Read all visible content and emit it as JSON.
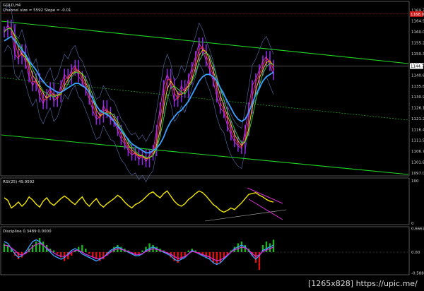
{
  "chart_data": [
    {
      "type": "line",
      "header_symbol": "GOLD,H4",
      "header_info": "Channel size = 5592 Slope = -0.01",
      "ylim": [
        1096,
        1173
      ],
      "y_ticks": [
        1169.75,
        1164.9,
        1160.05,
        1155.2,
        1150.35,
        1145.5,
        1140.65,
        1135.8,
        1130.95,
        1126.1,
        1121.25,
        1116.4,
        1111.55,
        1106.7,
        1101.85,
        1097.0
      ],
      "current_price": 1144.75,
      "level_price": 1168.0,
      "series": [
        {
          "kind": "price",
          "color": "#8a2be2",
          "values": [
            1160,
            1163,
            1161,
            1150,
            1148,
            1152,
            1146,
            1140,
            1136,
            1139,
            1131,
            1128,
            1132,
            1135,
            1129,
            1131,
            1136,
            1141,
            1139,
            1143,
            1145,
            1140,
            1138,
            1134,
            1130,
            1125,
            1121,
            1122,
            1127,
            1124,
            1121,
            1120,
            1116,
            1112,
            1110,
            1107,
            1105,
            1106,
            1103,
            1105,
            1102,
            1105,
            1107,
            1116,
            1126,
            1136,
            1141,
            1137,
            1129,
            1131,
            1136,
            1133,
            1139,
            1144,
            1149,
            1155,
            1152,
            1147,
            1143,
            1138,
            1131,
            1126,
            1124,
            1118,
            1114,
            1111,
            1109,
            1108,
            1116,
            1126,
            1136,
            1139,
            1143,
            1147,
            1149,
            1145,
            1141
          ]
        },
        {
          "kind": "ma_blue",
          "color": "#3aa0ff",
          "values": [
            1156,
            1157,
            1158,
            1156,
            1154,
            1152,
            1150,
            1147,
            1145,
            1143,
            1140,
            1138,
            1136,
            1135,
            1134,
            1133,
            1133,
            1134,
            1135,
            1136,
            1137,
            1137,
            1136,
            1135,
            1133,
            1130,
            1127,
            1125,
            1124,
            1123,
            1122,
            1120,
            1118,
            1116,
            1114,
            1112,
            1110,
            1109,
            1108,
            1107,
            1106,
            1106,
            1107,
            1108,
            1110,
            1113,
            1117,
            1120,
            1122,
            1124,
            1125,
            1127,
            1129,
            1132,
            1135,
            1138,
            1140,
            1141,
            1141,
            1140,
            1138,
            1135,
            1132,
            1129,
            1126,
            1123,
            1121,
            1120,
            1121,
            1124,
            1128,
            1132,
            1135,
            1138,
            1140,
            1141,
            1142
          ]
        }
      ]
    },
    {
      "type": "line",
      "title": "RSI(25) 49.9592",
      "ylim": [
        0,
        100
      ],
      "y_ticks": [
        100,
        0
      ],
      "series": [
        {
          "name": "RSI(25)",
          "color": "#f2e600",
          "values": [
            60,
            54,
            36,
            42,
            50,
            40,
            48,
            62,
            55,
            45,
            38,
            52,
            60,
            48,
            42,
            50,
            58,
            64,
            58,
            50,
            44,
            54,
            62,
            48,
            40,
            50,
            58,
            45,
            38,
            46,
            52,
            58,
            66,
            60,
            50,
            42,
            36,
            44,
            48,
            54,
            62,
            70,
            74,
            66,
            60,
            70,
            76,
            64,
            52,
            44,
            40,
            46,
            56,
            62,
            70,
            76,
            72,
            64,
            54,
            44,
            38,
            30,
            26,
            30,
            36,
            32,
            40,
            48,
            58,
            68,
            70,
            72,
            66,
            62,
            56,
            52,
            49.96
          ]
        }
      ]
    },
    {
      "type": "bar",
      "title": "Discipline 0.3489 0.0000",
      "ylim": [
        -0.58,
        0.66
      ],
      "y_ticks": [
        0.6667,
        0.0,
        -0.5882
      ],
      "series": [
        {
          "name": "histogram",
          "color_pos": "#1db51d",
          "color_neg": "#e01010",
          "values": [
            0.25,
            0.2,
            0.1,
            -0.1,
            -0.2,
            -0.15,
            -0.05,
            0.1,
            0.2,
            0.3,
            0.4,
            0.3,
            0.2,
            0.1,
            0.05,
            -0.05,
            -0.15,
            -0.25,
            -0.2,
            -0.1,
            0.05,
            0.15,
            0.2,
            0.1,
            -0.05,
            -0.15,
            -0.2,
            -0.25,
            -0.2,
            -0.1,
            0.05,
            0.15,
            0.2,
            0.15,
            0.1,
            0.05,
            -0.05,
            -0.1,
            -0.05,
            0.05,
            0.15,
            0.25,
            0.2,
            0.15,
            0.1,
            0.05,
            -0.05,
            -0.15,
            -0.25,
            -0.3,
            -0.2,
            -0.1,
            0.05,
            0.1,
            0.05,
            -0.05,
            -0.1,
            -0.15,
            -0.2,
            -0.3,
            -0.35,
            -0.3,
            -0.2,
            -0.1,
            0.05,
            0.15,
            0.25,
            0.3,
            0.2,
            0.1,
            -0.1,
            -0.3,
            -0.5,
            0.2,
            0.3,
            0.25,
            0.35
          ]
        },
        {
          "name": "line1",
          "color": "#3aa0ff",
          "values": [
            0.3,
            0.25,
            0.1,
            -0.05,
            -0.15,
            -0.1,
            0.0,
            0.15,
            0.3,
            0.35,
            0.3,
            0.2,
            0.1,
            0.0,
            -0.1,
            -0.15,
            -0.2,
            -0.15,
            -0.05,
            0.05,
            0.1,
            0.05,
            -0.05,
            -0.1,
            -0.15,
            -0.2,
            -0.25,
            -0.2,
            -0.15,
            -0.05,
            0.05,
            0.1,
            0.15,
            0.1,
            0.05,
            0.0,
            -0.05,
            -0.1,
            -0.1,
            -0.05,
            0.05,
            0.1,
            0.15,
            0.1,
            0.05,
            0.0,
            -0.05,
            -0.1,
            -0.2,
            -0.25,
            -0.2,
            -0.15,
            -0.05,
            0.05,
            0.0,
            -0.05,
            -0.1,
            -0.15,
            -0.2,
            -0.3,
            -0.35,
            -0.3,
            -0.2,
            -0.1,
            0.0,
            0.1,
            0.15,
            0.2,
            0.15,
            0.05,
            -0.1,
            -0.2,
            -0.1,
            0.05,
            0.1,
            0.15,
            0.2
          ]
        },
        {
          "name": "line2",
          "color": "#d42fd4",
          "values": [
            0.2,
            0.18,
            0.12,
            0.05,
            -0.05,
            -0.08,
            -0.04,
            0.05,
            0.15,
            0.22,
            0.25,
            0.2,
            0.12,
            0.05,
            -0.02,
            -0.08,
            -0.12,
            -0.12,
            -0.08,
            0.0,
            0.05,
            0.05,
            0.0,
            -0.06,
            -0.1,
            -0.14,
            -0.18,
            -0.18,
            -0.14,
            -0.08,
            0.0,
            0.06,
            0.1,
            0.08,
            0.05,
            0.02,
            -0.02,
            -0.06,
            -0.07,
            -0.04,
            0.02,
            0.06,
            0.1,
            0.08,
            0.05,
            0.02,
            -0.02,
            -0.06,
            -0.12,
            -0.18,
            -0.16,
            -0.12,
            -0.05,
            0.02,
            0.0,
            -0.03,
            -0.07,
            -0.1,
            -0.14,
            -0.2,
            -0.24,
            -0.22,
            -0.16,
            -0.08,
            0.0,
            0.06,
            0.1,
            0.14,
            0.12,
            0.06,
            -0.04,
            -0.12,
            -0.08,
            0.02,
            0.06,
            0.1,
            0.14
          ]
        }
      ]
    }
  ],
  "watermark": "[1265x828] https://upic.me/"
}
